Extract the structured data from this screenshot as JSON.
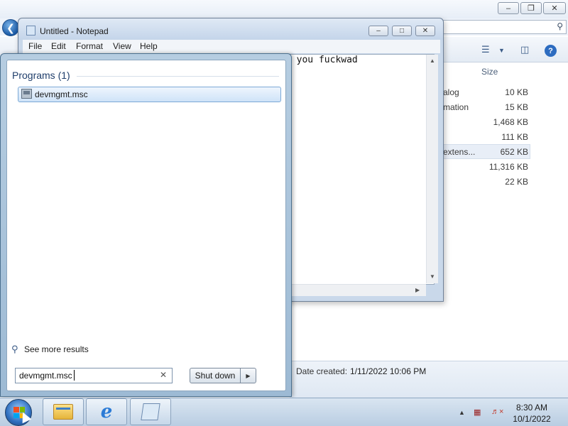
{
  "explorer": {
    "column_header_size": "Size",
    "file_fragments": [
      "alog",
      "mation",
      "",
      "",
      "extens...",
      "",
      ""
    ],
    "file_sizes": [
      "10 KB",
      "15 KB",
      "1,468 KB",
      "111 KB",
      "652 KB",
      "11,316 KB",
      "22 KB"
    ],
    "details": {
      "label": "Date created:",
      "value": "1/11/2022 10:06 PM"
    },
    "icons": {
      "back": "back-arrow-icon",
      "search": "search-icon",
      "views": "views-icon",
      "preview": "preview-pane-icon",
      "help": "help-icon"
    }
  },
  "notepad": {
    "title": "Untitled - Notepad",
    "menu": [
      "File",
      "Edit",
      "Format",
      "View",
      "Help"
    ],
    "content": "n you fuckwad"
  },
  "start_menu": {
    "section_title": "Programs (1)",
    "result_label": "devmgmt.msc",
    "see_more": "See more results",
    "search_value": "devmgmt.msc",
    "shutdown_label": "Shut down"
  },
  "taskbar": {
    "clock_time": "8:30 AM",
    "clock_date": "10/1/2022",
    "pinned": [
      "windows-explorer-icon",
      "internet-explorer-icon",
      "notepad-icon"
    ]
  },
  "colors": {
    "accent": "#2d6cc0",
    "taskbar": "#c6d7e9",
    "selection": "#cfe3f8"
  }
}
